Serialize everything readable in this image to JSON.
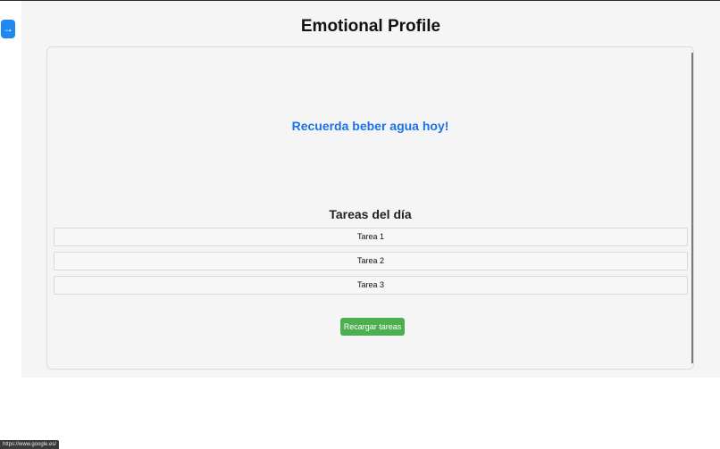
{
  "sidebar_toggle": {
    "icon": "arrow-right-icon",
    "glyph": "→"
  },
  "header": {
    "title": "Emotional Profile"
  },
  "card": {
    "reminder": "Recuerda beber agua hoy!",
    "tasks_title": "Tareas del día",
    "tasks": [
      "Tarea 1",
      "Tarea 2",
      "Tarea 3"
    ],
    "reload_label": "Recargar tareas"
  },
  "status_bar": {
    "url": "https://www.google.es/"
  },
  "colors": {
    "accent_blue": "#1a73e8",
    "toggle_blue": "#1e88f0",
    "button_green": "#4caf50",
    "page_bg": "#f5f5f5"
  }
}
